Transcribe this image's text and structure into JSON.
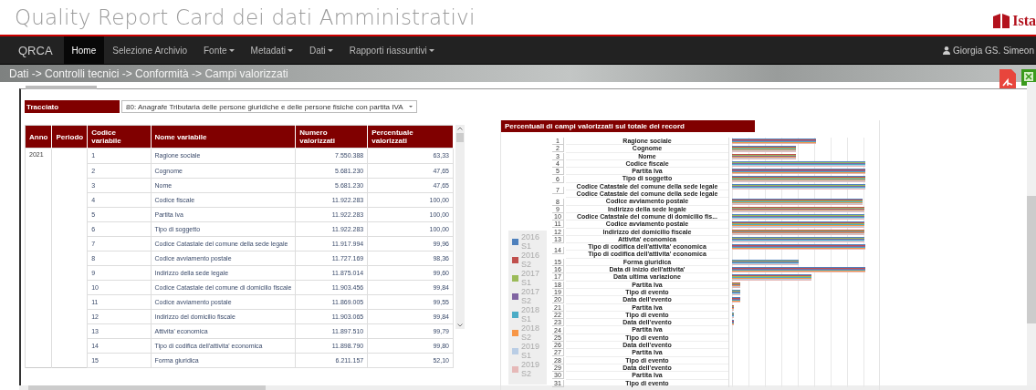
{
  "header": {
    "title": "Quality Report Card dei dati Amministrativi",
    "logo_text": "Ista"
  },
  "navbar": {
    "brand": "QRCA",
    "items": [
      {
        "label": "Home",
        "selected": true,
        "dropdown": false
      },
      {
        "label": "Selezione Archivio",
        "selected": false,
        "dropdown": false
      },
      {
        "label": "Fonte",
        "selected": false,
        "dropdown": true
      },
      {
        "label": "Metadati",
        "selected": false,
        "dropdown": true
      },
      {
        "label": "Dati",
        "selected": false,
        "dropdown": true
      },
      {
        "label": "Rapporti riassuntivi",
        "selected": false,
        "dropdown": true
      }
    ],
    "user": "Giorgia GS. Simeon"
  },
  "breadcrumb": "Dati -> Controlli tecnici -> Conformità -> Campi valorizzati",
  "tracciato": {
    "label": "Tracciato",
    "value": "80: Anagrafe Tributaria delle persone giuridiche e delle persone fisiche con partita IVA"
  },
  "table": {
    "columns": [
      "Anno",
      "Periodo",
      "Codice variabile",
      "Nome variabile",
      "Numero valorizzati",
      "Percentuale valorizzati"
    ],
    "rows": [
      [
        "2021",
        "",
        "1",
        "Ragione sociale",
        "7.550.388",
        "63,33"
      ],
      [
        "",
        "",
        "2",
        "Cognome",
        "5.681.230",
        "47,65"
      ],
      [
        "",
        "",
        "3",
        "Nome",
        "5.681.230",
        "47,65"
      ],
      [
        "",
        "",
        "4",
        "Codice fiscale",
        "11.922.283",
        "100,00"
      ],
      [
        "",
        "",
        "5",
        "Partita Iva",
        "11.922.283",
        "100,00"
      ],
      [
        "",
        "",
        "6",
        "Tipo di soggetto",
        "11.922.283",
        "100,00"
      ],
      [
        "",
        "",
        "7",
        "Codice Catastale del comune della sede legale",
        "11.917.994",
        "99,96"
      ],
      [
        "",
        "",
        "8",
        "Codice avviamento postale",
        "11.727.169",
        "98,36"
      ],
      [
        "",
        "",
        "9",
        "Indirizzo della sede legale",
        "11.875.014",
        "99,60"
      ],
      [
        "",
        "",
        "10",
        "Codice Catastale del comune di domicilio fiscale",
        "11.903.456",
        "99,84"
      ],
      [
        "",
        "",
        "11",
        "Codice avviamento postale",
        "11.869.005",
        "99,55"
      ],
      [
        "",
        "",
        "12",
        "Indirizzo del domicilio fiscale",
        "11.903.065",
        "99,84"
      ],
      [
        "",
        "",
        "13",
        "Attivita' economica",
        "11.897.510",
        "99,79"
      ],
      [
        "",
        "",
        "14",
        "Tipo di codifica dell'attivita' economica",
        "11.898.790",
        "99,80"
      ],
      [
        "",
        "",
        "15",
        "Forma giuridica",
        "6.211.157",
        "52,10"
      ]
    ]
  },
  "chart": {
    "title": "Percentuali di campi valorizzati sul totale dei record",
    "legend": [
      {
        "year": "2016",
        "period": "S1",
        "color": "#4f81bd"
      },
      {
        "year": "2016",
        "period": "S2",
        "color": "#c0504d"
      },
      {
        "year": "2017",
        "period": "S1",
        "color": "#9bbb59"
      },
      {
        "year": "2017",
        "period": "S2",
        "color": "#8064a2"
      },
      {
        "year": "2018",
        "period": "S1",
        "color": "#4bacc6"
      },
      {
        "year": "2018",
        "period": "S2",
        "color": "#f79646"
      },
      {
        "year": "2019",
        "period": "S1",
        "color": "#b9cde5"
      },
      {
        "year": "2019",
        "period": "S2",
        "color": "#e6b9b8"
      }
    ],
    "rows": [
      {
        "number": "1",
        "labels": [
          "Ragione sociale"
        ]
      },
      {
        "number": "2",
        "labels": [
          "Cognome"
        ]
      },
      {
        "number": "3",
        "labels": [
          "Nome"
        ]
      },
      {
        "number": "4",
        "labels": [
          "Codice fiscale"
        ]
      },
      {
        "number": "5",
        "labels": [
          "Partita Iva"
        ]
      },
      {
        "number": "6",
        "labels": [
          "Tipo di soggetto"
        ]
      },
      {
        "number": "7",
        "labels": [
          "Codice Catastale del comune della sede legale",
          "Codice Catastale del comune della sede legale"
        ]
      },
      {
        "number": "8",
        "labels": [
          "Codice avviamento postale"
        ]
      },
      {
        "number": "9",
        "labels": [
          "Indirizzo della sede legale"
        ]
      },
      {
        "number": "10",
        "labels": [
          "Codice Catastale del comune di domicilio fis..."
        ]
      },
      {
        "number": "11",
        "labels": [
          "Codice avviamento postale"
        ]
      },
      {
        "number": "12",
        "labels": [
          "Indirizzo del domicilio fiscale"
        ]
      },
      {
        "number": "13",
        "labels": [
          "Attivita' economica"
        ]
      },
      {
        "number": "14",
        "labels": [
          "Tipo di codifica dell'attivita' economica",
          "Tipo di codifica dell'attivita' economica"
        ]
      },
      {
        "number": "15",
        "labels": [
          "Forma giuridica"
        ]
      },
      {
        "number": "16",
        "labels": [
          "Data di inizio dell'attivita'"
        ]
      },
      {
        "number": "17",
        "labels": [
          "Data ultima variazione"
        ]
      },
      {
        "number": "18",
        "labels": [
          "Partita Iva"
        ]
      },
      {
        "number": "19",
        "labels": [
          "Tipo di evento"
        ]
      },
      {
        "number": "20",
        "labels": [
          "Data dell'evento"
        ]
      },
      {
        "number": "21",
        "labels": [
          "Partita Iva"
        ]
      },
      {
        "number": "22",
        "labels": [
          "Tipo di evento"
        ]
      },
      {
        "number": "23",
        "labels": [
          "Data dell'evento"
        ]
      },
      {
        "number": "24",
        "labels": [
          "Partita Iva"
        ]
      },
      {
        "number": "25",
        "labels": [
          "Tipo di evento"
        ]
      },
      {
        "number": "26",
        "labels": [
          "Data dell'evento"
        ]
      },
      {
        "number": "27",
        "labels": [
          "Partita Iva"
        ]
      },
      {
        "number": "28",
        "labels": [
          "Tipo di evento"
        ]
      },
      {
        "number": "29",
        "labels": [
          "Data dell'evento"
        ]
      },
      {
        "number": "30",
        "labels": [
          "Partita Iva"
        ]
      },
      {
        "number": "31",
        "labels": [
          "Tipo di evento"
        ]
      }
    ]
  }
}
